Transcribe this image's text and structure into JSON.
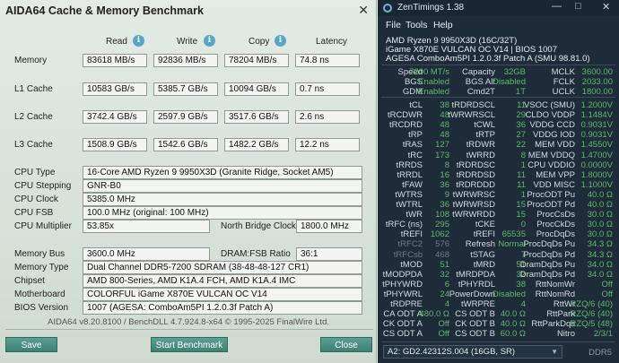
{
  "aida": {
    "title": "AIDA64 Cache & Memory Benchmark",
    "close": "✕",
    "headers": {
      "read": "Read",
      "write": "Write",
      "copy": "Copy",
      "latency": "Latency"
    },
    "info_glyph": "i",
    "bench": [
      {
        "label": "Memory",
        "read": "83618 MB/s",
        "write": "92836 MB/s",
        "copy": "78204 MB/s",
        "latency": "74.8 ns"
      },
      {
        "label": "L1 Cache",
        "read": "10583 GB/s",
        "write": "5385.7 GB/s",
        "copy": "10094 GB/s",
        "latency": "0.7 ns"
      },
      {
        "label": "L2 Cache",
        "read": "3742.4 GB/s",
        "write": "2597.9 GB/s",
        "copy": "3517.6 GB/s",
        "latency": "2.6 ns"
      },
      {
        "label": "L3 Cache",
        "read": "1508.9 GB/s",
        "write": "1542.6 GB/s",
        "copy": "1482.2 GB/s",
        "latency": "12.2 ns"
      }
    ],
    "cpu": {
      "type_label": "CPU Type",
      "type": "16-Core AMD Ryzen 9 9950X3D  (Granite Ridge, Socket AM5)",
      "stepping_label": "CPU Stepping",
      "stepping": "GNR-B0",
      "clock_label": "CPU Clock",
      "clock": "5385.0 MHz",
      "fsb_label": "CPU FSB",
      "fsb": "100.0 MHz  (original: 100 MHz)",
      "mult_label": "CPU Multiplier",
      "mult": "53.85x",
      "nb_label": "North Bridge Clock",
      "nb": "1800.0 MHz"
    },
    "mem": {
      "bus_label": "Memory Bus",
      "bus": "3600.0 MHz",
      "ratio_label": "DRAM:FSB Ratio",
      "ratio": "36:1",
      "type_label": "Memory Type",
      "type": "Dual Channel DDR5-7200 SDRAM  (38-48-48-127 CR1)",
      "chipset_label": "Chipset",
      "chipset": "AMD 800-Series, AMD K1A.4 FCH, AMD K1A.4 IMC",
      "mb_label": "Motherboard",
      "mb": "COLORFUL iGame X870E VULCAN OC V14",
      "bios_label": "BIOS Version",
      "bios": "1007  (AGESA: ComboAm5PI 1.2.0.3f Patch A)"
    },
    "footer": "AIDA64 v8.20.8100 / BenchDLL 4.7.924.8-x64  © 1995-2025 FinalWire Ltd.",
    "buttons": {
      "save": "Save",
      "start": "Start Benchmark",
      "close": "Close"
    }
  },
  "zen": {
    "title": "ZenTimings 1.38",
    "window_buttons": {
      "minimize": "—",
      "maximize": "□",
      "close": "✕"
    },
    "menu": [
      "File",
      "Tools",
      "Help"
    ],
    "sysinfo": [
      "AMD Ryzen 9 9950X3D (16C/32T)",
      "iGame X870E VULCAN OC V14 | BIOS 1007",
      "AGESA ComboAm5PI 1.2.0.3f Patch A (SMU 98.81.0)"
    ],
    "top_rows": [
      [
        "Speed",
        "7200 MT/s",
        "Capacity",
        "32GB",
        "MCLK",
        "3600.00"
      ],
      [
        "BGS",
        "Enabled",
        "BGS Alt",
        "Disabled",
        "FCLK",
        "2033.00"
      ],
      [
        "GDM",
        "Enabled",
        "Cmd2T",
        "1T",
        "UCLK",
        "1800.00"
      ]
    ],
    "rows": [
      [
        "tCL",
        "38",
        "tRDRDSCL",
        "11",
        "VSOC (SMU)",
        "1.2000V"
      ],
      [
        "tRCDWR",
        "48",
        "tWRWRSCL",
        "29",
        "CLDO VDDP",
        "1.1484V"
      ],
      [
        "tRCDRD",
        "48",
        "tCWL",
        "36",
        "VDDG CCD",
        "0.9031V"
      ],
      [
        "tRP",
        "48",
        "tRTP",
        "27",
        "VDDG IOD",
        "0.9031V"
      ],
      [
        "tRAS",
        "127",
        "tRDWR",
        "22",
        "MEM VDD",
        "1.4550V"
      ],
      [
        "tRC",
        "173",
        "tWRRD",
        "8",
        "MEM VDDQ",
        "1.4700V"
      ],
      [
        "tRRDS",
        "8",
        "tRDRDSC",
        "1",
        "CPU VDDIO",
        "0.0000V"
      ],
      [
        "tRRDL",
        "16",
        "tRDRDSD",
        "11",
        "MEM VPP",
        "1.8000V"
      ],
      [
        "tFAW",
        "36",
        "tRDRDDD",
        "11",
        "VDD MISC",
        "1.1000V"
      ],
      [
        "tWTRS",
        "9",
        "tWRWRSC",
        "1",
        "ProcODT Pu",
        "40.0 Ω"
      ],
      [
        "tWTRL",
        "36",
        "tWRWRSD",
        "15",
        "ProcODT Pd",
        "40.0 Ω"
      ],
      [
        "tWR",
        "108",
        "tWRWRDD",
        "15",
        "ProcCsDs",
        "30.0 Ω"
      ],
      [
        "tRFC (ns)",
        "295",
        "tCKE",
        "0",
        "ProcCkDs",
        "30.0 Ω"
      ],
      [
        "tREFI",
        "1062",
        "tREFI",
        "65535",
        "ProcDqDs",
        "30.0 Ω"
      ],
      [
        "tRFC2",
        "576",
        "Refresh",
        "Normal",
        "ProcDqDs Pu",
        "34.3 Ω"
      ],
      [
        "tRFCsb",
        "468",
        "tSTAG",
        "7",
        "ProcDqDs Pd",
        "34.3 Ω"
      ],
      [
        "tMOD",
        "51",
        "tMRD",
        "51",
        "DramDqDs Pu",
        "34.0 Ω"
      ],
      [
        "tMODPDA",
        "32",
        "tMRDPDA",
        "32",
        "DramDqDs Pd",
        "34.0 Ω"
      ],
      [
        "tPHYWRD",
        "6",
        "tPHYRDL",
        "38",
        "RttNomWr",
        "Off"
      ],
      [
        "tPHYWRL",
        "24",
        "PowerDown",
        "Disabled",
        "RttNomRd",
        "Off"
      ],
      [
        "tRDPRE",
        "4",
        "tWRPRE",
        "4",
        "RttWr",
        "RZQ/6 (40)"
      ],
      [
        "CA ODT A",
        "480.0 Ω",
        "CS ODT B",
        "40.0 Ω",
        "RttPark",
        "RZQ/6 (40)"
      ],
      [
        "CK ODT A",
        "Off",
        "CK ODT B",
        "40.0 Ω",
        "RttParkDqs",
        "RZQ/5 (48)"
      ],
      [
        "CS ODT A",
        "Off",
        "CS ODT B",
        "60.0 Ω",
        "Nitro",
        "2/3/1"
      ]
    ],
    "dim_rows": [
      14,
      15
    ],
    "dropdown": "A2: GD2.42312S.004 (16GB, SR)",
    "caret": "▼",
    "ddr_label": "DDR5",
    "colors": {
      "value": "#5fb86a",
      "bg": "#1e2c3a",
      "aida_button": "#4a8e80"
    }
  }
}
